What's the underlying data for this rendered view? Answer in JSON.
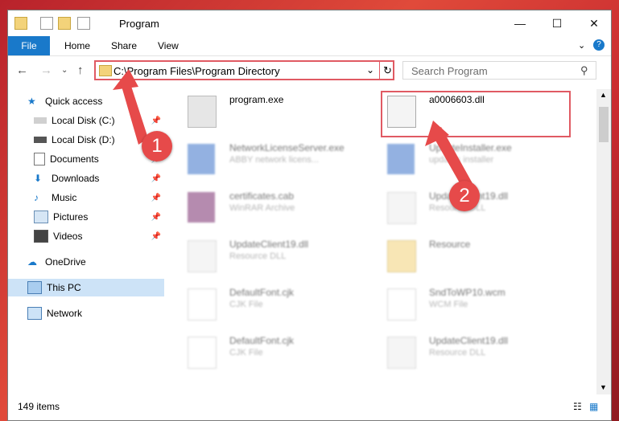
{
  "window": {
    "title": "Program"
  },
  "ribbon": {
    "file": "File",
    "tabs": [
      "Home",
      "Share",
      "View"
    ]
  },
  "address": {
    "path": "C:\\Program Files\\Program Directory"
  },
  "search": {
    "placeholder": "Search Program"
  },
  "sidebar": {
    "items": [
      {
        "label": "Quick access",
        "icon": "star-icon"
      },
      {
        "label": "Local Disk (C:)",
        "icon": "drive-icon"
      },
      {
        "label": "Local Disk (D:)",
        "icon": "drive-icon"
      },
      {
        "label": "Documents",
        "icon": "documents-icon"
      },
      {
        "label": "Downloads",
        "icon": "download-icon"
      },
      {
        "label": "Music",
        "icon": "music-icon"
      },
      {
        "label": "Pictures",
        "icon": "pictures-icon"
      },
      {
        "label": "Videos",
        "icon": "videos-icon"
      },
      {
        "label": "OneDrive",
        "icon": "cloud-icon"
      },
      {
        "label": "This PC",
        "icon": "computer-icon"
      },
      {
        "label": "Network",
        "icon": "network-icon"
      }
    ]
  },
  "files": [
    {
      "name": "program.exe",
      "type": ""
    },
    {
      "name": "a0006603.dll",
      "type": ""
    },
    {
      "name": "NetworkLicenseServer.exe",
      "type": "ABBY network licens..."
    },
    {
      "name": "UpdateInstaller.exe",
      "type": "updates installer"
    },
    {
      "name": "certificates.cab",
      "type": "WinRAR Archive"
    },
    {
      "name": "UpdateClient19.dll",
      "type": "Resource DLL"
    },
    {
      "name": "UpdateClient19.dll",
      "type": "Resource DLL"
    },
    {
      "name": "Resource",
      "type": ""
    },
    {
      "name": "DefaultFont.cjk",
      "type": "CJK File"
    },
    {
      "name": "SndToWP10.wcm",
      "type": "WCM File"
    },
    {
      "name": "DefaultFont.cjk",
      "type": "CJK File"
    },
    {
      "name": "UpdateClient19.dll",
      "type": "Resource DLL"
    }
  ],
  "status": {
    "count": "149 items"
  },
  "markers": [
    "1",
    "2"
  ],
  "colors": {
    "accent": "#1979ca",
    "highlight": "#e05a63",
    "marker": "#e64a4a"
  }
}
